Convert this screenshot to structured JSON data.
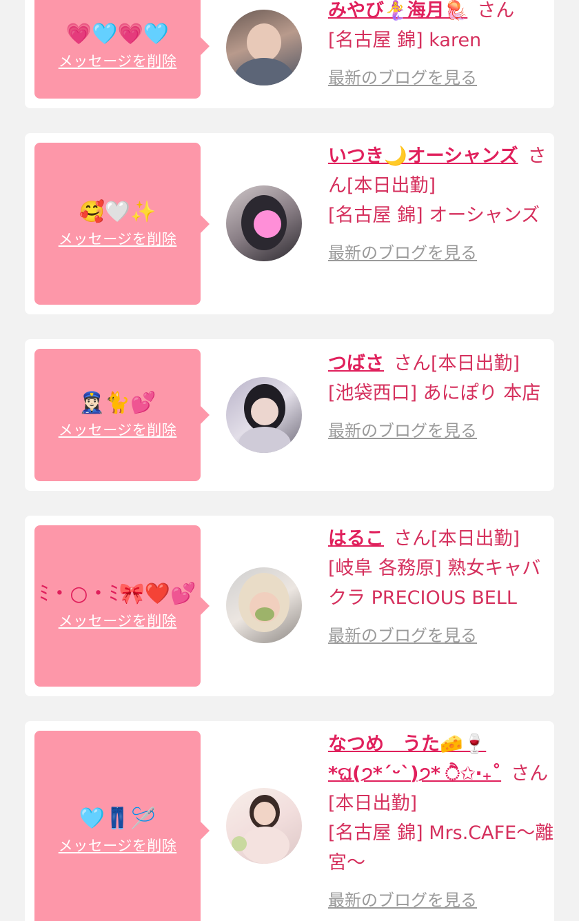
{
  "cards": [
    {
      "message": "💗🩵💗🩵",
      "delete_label": "メッセージを削除",
      "name": "みやび🧜‍♀️海月🪼",
      "honorific": "さん",
      "status": "",
      "shop": "[名古屋 錦] karen",
      "blog_label": "最新のブログを見る"
    },
    {
      "message": "🥰🤍✨",
      "delete_label": "メッセージを削除",
      "name": "いつき🌙オーシャンズ",
      "honorific": "さん",
      "status": "[本日出勤]",
      "shop": "[名古屋 錦] オーシャンズ",
      "blog_label": "最新のブログを見る"
    },
    {
      "message": "👮🏻‍♀️🐈💕",
      "delete_label": "メッセージを削除",
      "name": "つばさ",
      "honorific": "さん",
      "status": "[本日出勤]",
      "shop": "[池袋西口] あにぽり 本店",
      "blog_label": "最新のブログを見る"
    },
    {
      "message": "ﾐ・○・ﾐ🎀❤️💕",
      "delete_label": "メッセージを削除",
      "name": "はるこ",
      "honorific": "さん",
      "status": "[本日出勤]",
      "shop": "[岐阜 各務原]  熟女キャバクラ PRECIOUS BELL",
      "blog_label": "最新のブログを見る"
    },
    {
      "message": "🩵👖🪡",
      "delete_label": "メッセージを削除",
      "name": "なつめ　うた🧀🍷 *ଘ(੭*ˊᵕˋ)੭* ੈ✩‧₊˚",
      "honorific": "さん",
      "status": "[本日出勤]",
      "shop": "[名古屋 錦] Mrs.CAFE〜離宮〜",
      "blog_label": "最新のブログを見る"
    }
  ],
  "colors": {
    "accent": "#e0205c",
    "bubble": "#fd97a9",
    "link_gray": "#9a9a9a",
    "background": "#f2f2f2"
  }
}
